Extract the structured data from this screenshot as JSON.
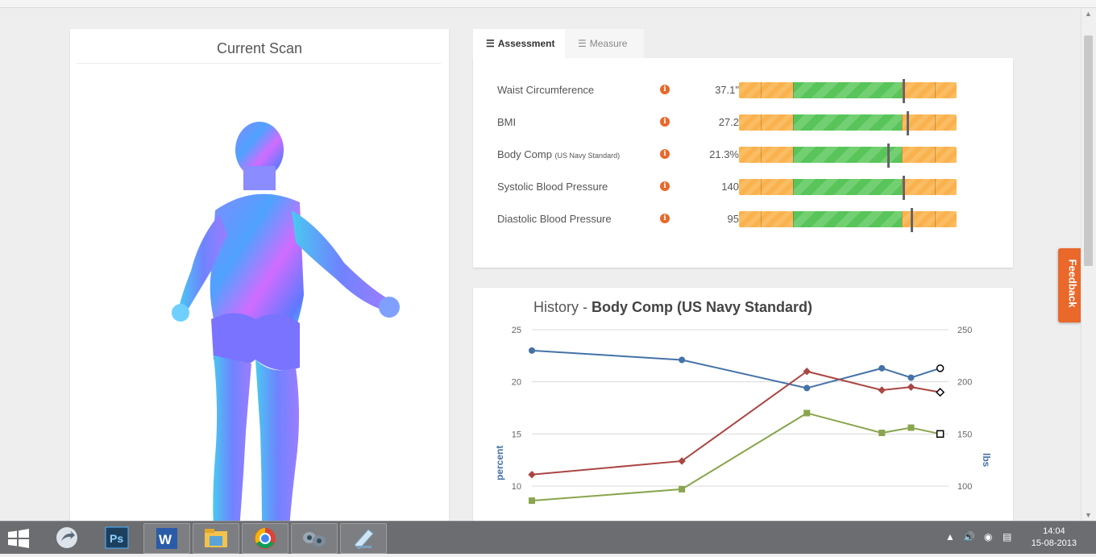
{
  "scan": {
    "title": "Current Scan"
  },
  "tabs": [
    {
      "label": "Assessment",
      "active": true,
      "icon": "list-icon"
    },
    {
      "label": "Measure",
      "active": false,
      "icon": "list-icon"
    }
  ],
  "assessment": [
    {
      "label": "Waist Circumference",
      "note": "",
      "value": "37.1\"",
      "level": 0.75
    },
    {
      "label": "BMI",
      "note": "",
      "value": "27.2",
      "level": 0.77
    },
    {
      "label": "Body Comp",
      "note": "(US Navy Standard)",
      "value": "21.3%",
      "level": 0.68
    },
    {
      "label": "Systolic Blood Pressure",
      "note": "",
      "value": "140",
      "level": 0.75
    },
    {
      "label": "Diastolic Blood Pressure",
      "note": "",
      "value": "95",
      "level": 0.79
    }
  ],
  "history": {
    "prefix": "History - ",
    "metric": "Body Comp (US Navy Standard)"
  },
  "chart_data": {
    "type": "line",
    "title": "History - Body Comp (US Navy Standard)",
    "ylabel": "percent",
    "y2label": "lbs",
    "ylim": [
      10,
      25
    ],
    "y2lim": [
      100,
      250
    ],
    "yticks": [
      "25",
      "20",
      "15",
      "10"
    ],
    "y2ticks": [
      "250",
      "200",
      "150",
      "100"
    ],
    "grid": true,
    "x": [
      0,
      1,
      2,
      3,
      4,
      5
    ],
    "xposition": [
      0,
      0.36,
      0.66,
      0.84,
      0.91,
      0.98
    ],
    "series": [
      {
        "color": "#4572a7",
        "axis": "left",
        "marker": "circle",
        "values": [
          23.0,
          22.1,
          19.4,
          21.3,
          20.4,
          21.3
        ]
      },
      {
        "color": "#aa4643",
        "axis": "right",
        "marker": "diamond",
        "values": [
          111,
          124,
          210,
          192,
          195,
          190
        ]
      },
      {
        "color": "#89a54e",
        "axis": "left",
        "marker": "square",
        "values": [
          8.6,
          9.7,
          17.0,
          15.1,
          15.6,
          15.0
        ]
      }
    ]
  },
  "feedback": {
    "label": "Feedback"
  },
  "taskbar": {
    "time": "14:04",
    "date": "15-08-2013"
  }
}
